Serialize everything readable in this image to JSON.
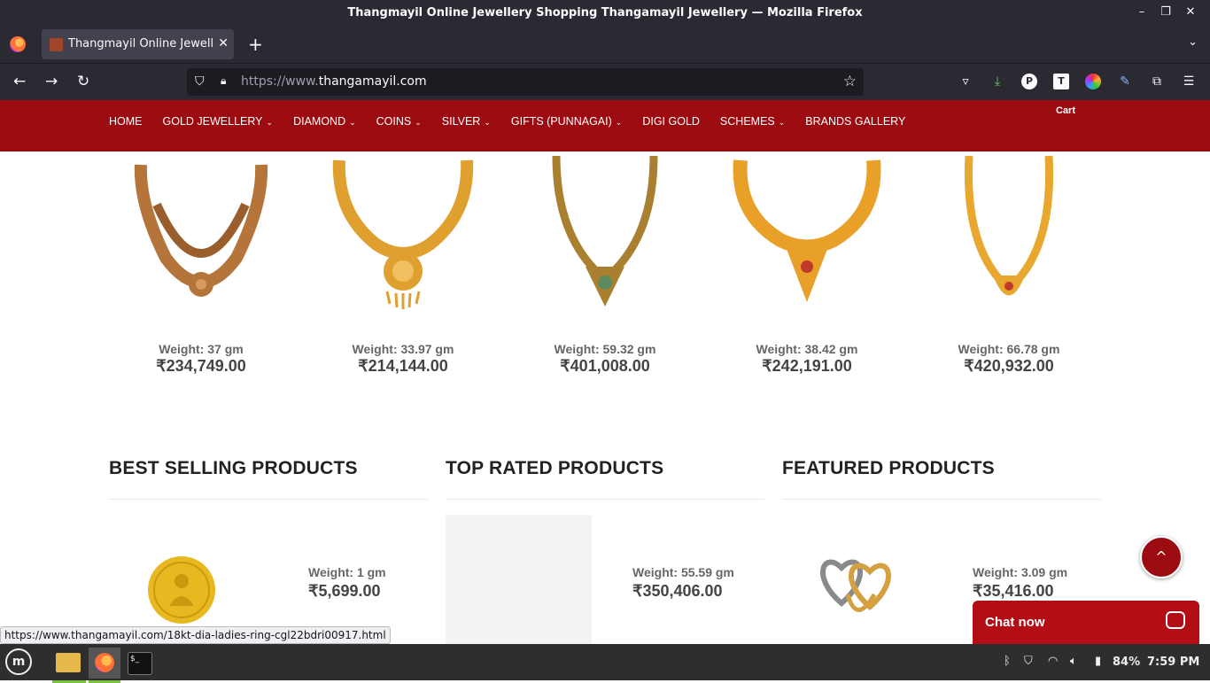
{
  "window": {
    "title": "Thangmayil Online Jewellery Shopping Thangamayil Jewellery — Mozilla Firefox",
    "minimize": "–",
    "restore": "❐",
    "close": "✕"
  },
  "tab": {
    "label": "Thangmayil Online Jewellery",
    "close": "✕",
    "new_tab": "+",
    "list": "⌄"
  },
  "toolbar": {
    "url_prefix": "https://www.",
    "url_domain": "thangamayil.com",
    "back": "←",
    "forward": "→",
    "reload": "↻",
    "star": "☆",
    "menu": "☰"
  },
  "site_nav": {
    "items": [
      {
        "label": "HOME",
        "has_dropdown": false
      },
      {
        "label": "GOLD JEWELLERY",
        "has_dropdown": true
      },
      {
        "label": "DIAMOND",
        "has_dropdown": true
      },
      {
        "label": "COINS",
        "has_dropdown": true
      },
      {
        "label": "SILVER",
        "has_dropdown": true
      },
      {
        "label": "GIFTS (PUNNAGAI)",
        "has_dropdown": true
      },
      {
        "label": "DIGI GOLD",
        "has_dropdown": false
      },
      {
        "label": "SCHEMES",
        "has_dropdown": true
      },
      {
        "label": "BRANDS GALLERY",
        "has_dropdown": false
      }
    ],
    "cart_label": "Cart",
    "caret": "⌄",
    "accent_color": "#9b0b10"
  },
  "products": [
    {
      "weight": "Weight: 37 gm",
      "price": "₹234,749.00",
      "tone": "#b5753a"
    },
    {
      "weight": "Weight: 33.97 gm",
      "price": "₹214,144.00",
      "tone": "#e0a030"
    },
    {
      "weight": "Weight: 59.32 gm",
      "price": "₹401,008.00",
      "tone": "#a88030"
    },
    {
      "weight": "Weight: 38.42 gm",
      "price": "₹242,191.00",
      "tone": "#e8a028"
    },
    {
      "weight": "Weight: 66.78 gm",
      "price": "₹420,932.00",
      "tone": "#e8a830"
    }
  ],
  "sections": {
    "best_selling": {
      "title": "BEST SELLING PRODUCTS",
      "weight": "Weight: 1 gm",
      "price": "₹5,699.00"
    },
    "top_rated": {
      "title": "TOP RATED PRODUCTS",
      "weight": "Weight: 55.59 gm",
      "price": "₹350,406.00"
    },
    "featured": {
      "title": "FEATURED PRODUCTS",
      "weight": "Weight: 3.09 gm",
      "price": "₹35,416.00"
    }
  },
  "scroll_top_label": "^",
  "chat": {
    "label": "Chat now"
  },
  "status_url": "https://www.thangamayil.com/18kt-dia-ladies-ring-cgl22bdri00917.html",
  "taskbar": {
    "battery": "84%",
    "clock": "7:59 PM",
    "terminal_glyph": "$_"
  }
}
